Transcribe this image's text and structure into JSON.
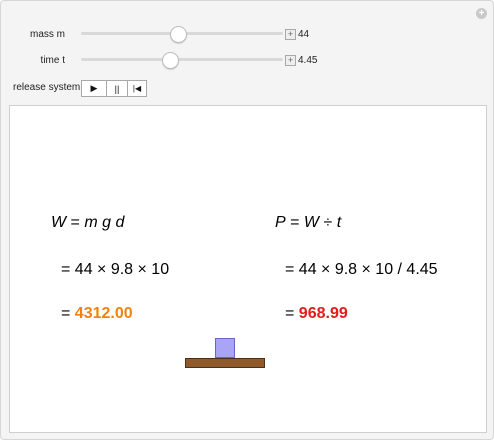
{
  "controls": {
    "mass": {
      "label": "mass m",
      "value": "44",
      "fraction": 0.48
    },
    "time": {
      "label": "time t",
      "value": "4.45",
      "fraction": 0.44
    },
    "release": {
      "label": "release system",
      "play": "▶",
      "pause": "||",
      "reset": "|◀"
    },
    "corner_icon": "+"
  },
  "equations": {
    "work_formula": {
      "lhs": "W",
      "eq": " = ",
      "rhs": "m g d"
    },
    "power_formula": {
      "lhs": "P",
      "eq": " = ",
      "rhs_w": "W",
      "div": " ÷ ",
      "rhs_t": "t"
    },
    "work_substitution": "= 44 × 9.8 × 10",
    "power_substitution": "= 44 × 9.8 × 10 / 4.45",
    "work_result_prefix": "= ",
    "work_result": "4312.00",
    "power_result_prefix": "= ",
    "power_result": "968.99"
  },
  "colors": {
    "work_result": "#f0820f",
    "power_result": "#e31b1b",
    "block": "#a9a4f5",
    "platform": "#8f5a2b"
  }
}
